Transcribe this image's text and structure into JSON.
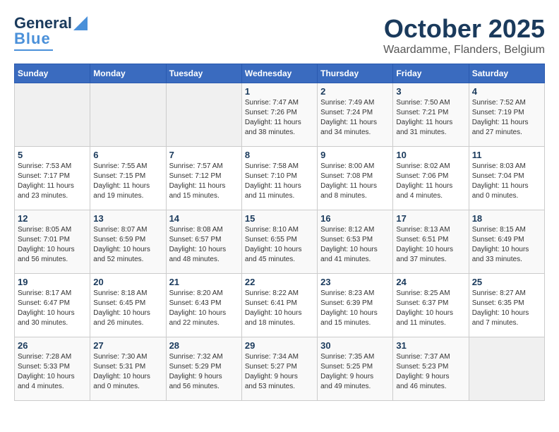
{
  "header": {
    "logo_general": "General",
    "logo_blue": "Blue",
    "title": "October 2025",
    "subtitle": "Waardamme, Flanders, Belgium"
  },
  "weekdays": [
    "Sunday",
    "Monday",
    "Tuesday",
    "Wednesday",
    "Thursday",
    "Friday",
    "Saturday"
  ],
  "weeks": [
    [
      {
        "day": "",
        "info": ""
      },
      {
        "day": "",
        "info": ""
      },
      {
        "day": "",
        "info": ""
      },
      {
        "day": "1",
        "info": "Sunrise: 7:47 AM\nSunset: 7:26 PM\nDaylight: 11 hours\nand 38 minutes."
      },
      {
        "day": "2",
        "info": "Sunrise: 7:49 AM\nSunset: 7:24 PM\nDaylight: 11 hours\nand 34 minutes."
      },
      {
        "day": "3",
        "info": "Sunrise: 7:50 AM\nSunset: 7:21 PM\nDaylight: 11 hours\nand 31 minutes."
      },
      {
        "day": "4",
        "info": "Sunrise: 7:52 AM\nSunset: 7:19 PM\nDaylight: 11 hours\nand 27 minutes."
      }
    ],
    [
      {
        "day": "5",
        "info": "Sunrise: 7:53 AM\nSunset: 7:17 PM\nDaylight: 11 hours\nand 23 minutes."
      },
      {
        "day": "6",
        "info": "Sunrise: 7:55 AM\nSunset: 7:15 PM\nDaylight: 11 hours\nand 19 minutes."
      },
      {
        "day": "7",
        "info": "Sunrise: 7:57 AM\nSunset: 7:12 PM\nDaylight: 11 hours\nand 15 minutes."
      },
      {
        "day": "8",
        "info": "Sunrise: 7:58 AM\nSunset: 7:10 PM\nDaylight: 11 hours\nand 11 minutes."
      },
      {
        "day": "9",
        "info": "Sunrise: 8:00 AM\nSunset: 7:08 PM\nDaylight: 11 hours\nand 8 minutes."
      },
      {
        "day": "10",
        "info": "Sunrise: 8:02 AM\nSunset: 7:06 PM\nDaylight: 11 hours\nand 4 minutes."
      },
      {
        "day": "11",
        "info": "Sunrise: 8:03 AM\nSunset: 7:04 PM\nDaylight: 11 hours\nand 0 minutes."
      }
    ],
    [
      {
        "day": "12",
        "info": "Sunrise: 8:05 AM\nSunset: 7:01 PM\nDaylight: 10 hours\nand 56 minutes."
      },
      {
        "day": "13",
        "info": "Sunrise: 8:07 AM\nSunset: 6:59 PM\nDaylight: 10 hours\nand 52 minutes."
      },
      {
        "day": "14",
        "info": "Sunrise: 8:08 AM\nSunset: 6:57 PM\nDaylight: 10 hours\nand 48 minutes."
      },
      {
        "day": "15",
        "info": "Sunrise: 8:10 AM\nSunset: 6:55 PM\nDaylight: 10 hours\nand 45 minutes."
      },
      {
        "day": "16",
        "info": "Sunrise: 8:12 AM\nSunset: 6:53 PM\nDaylight: 10 hours\nand 41 minutes."
      },
      {
        "day": "17",
        "info": "Sunrise: 8:13 AM\nSunset: 6:51 PM\nDaylight: 10 hours\nand 37 minutes."
      },
      {
        "day": "18",
        "info": "Sunrise: 8:15 AM\nSunset: 6:49 PM\nDaylight: 10 hours\nand 33 minutes."
      }
    ],
    [
      {
        "day": "19",
        "info": "Sunrise: 8:17 AM\nSunset: 6:47 PM\nDaylight: 10 hours\nand 30 minutes."
      },
      {
        "day": "20",
        "info": "Sunrise: 8:18 AM\nSunset: 6:45 PM\nDaylight: 10 hours\nand 26 minutes."
      },
      {
        "day": "21",
        "info": "Sunrise: 8:20 AM\nSunset: 6:43 PM\nDaylight: 10 hours\nand 22 minutes."
      },
      {
        "day": "22",
        "info": "Sunrise: 8:22 AM\nSunset: 6:41 PM\nDaylight: 10 hours\nand 18 minutes."
      },
      {
        "day": "23",
        "info": "Sunrise: 8:23 AM\nSunset: 6:39 PM\nDaylight: 10 hours\nand 15 minutes."
      },
      {
        "day": "24",
        "info": "Sunrise: 8:25 AM\nSunset: 6:37 PM\nDaylight: 10 hours\nand 11 minutes."
      },
      {
        "day": "25",
        "info": "Sunrise: 8:27 AM\nSunset: 6:35 PM\nDaylight: 10 hours\nand 7 minutes."
      }
    ],
    [
      {
        "day": "26",
        "info": "Sunrise: 7:28 AM\nSunset: 5:33 PM\nDaylight: 10 hours\nand 4 minutes."
      },
      {
        "day": "27",
        "info": "Sunrise: 7:30 AM\nSunset: 5:31 PM\nDaylight: 10 hours\nand 0 minutes."
      },
      {
        "day": "28",
        "info": "Sunrise: 7:32 AM\nSunset: 5:29 PM\nDaylight: 9 hours\nand 56 minutes."
      },
      {
        "day": "29",
        "info": "Sunrise: 7:34 AM\nSunset: 5:27 PM\nDaylight: 9 hours\nand 53 minutes."
      },
      {
        "day": "30",
        "info": "Sunrise: 7:35 AM\nSunset: 5:25 PM\nDaylight: 9 hours\nand 49 minutes."
      },
      {
        "day": "31",
        "info": "Sunrise: 7:37 AM\nSunset: 5:23 PM\nDaylight: 9 hours\nand 46 minutes."
      },
      {
        "day": "",
        "info": ""
      }
    ]
  ]
}
